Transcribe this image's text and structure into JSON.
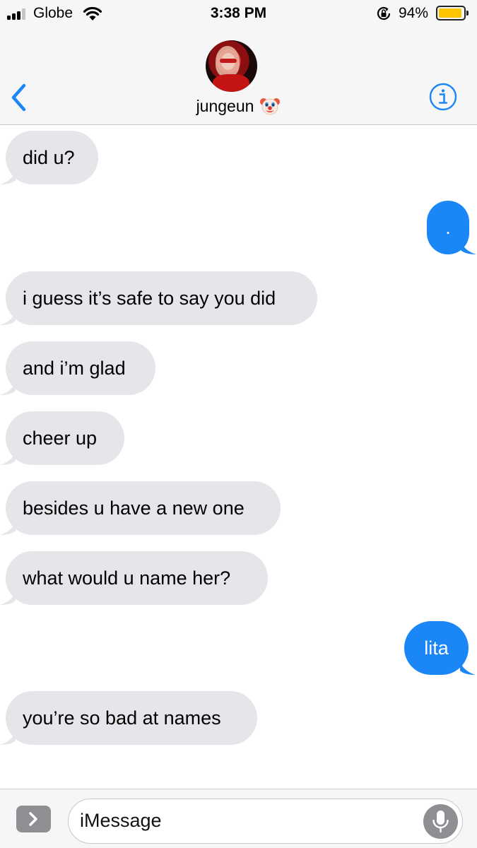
{
  "status_bar": {
    "carrier": "Globe",
    "signal_bars_filled": 3,
    "signal_bars_total": 4,
    "time": "3:38 PM",
    "battery_percent": "94%",
    "battery_level": 0.94,
    "battery_color": "#fdc500",
    "icons": [
      "signal-icon",
      "wifi-icon",
      "rotation-lock-icon",
      "battery-icon"
    ]
  },
  "header": {
    "contact_name": "jungeun",
    "contact_emoji": "clown-face-emoji",
    "back_icon": "chevron-left-icon",
    "info_icon": "info-icon",
    "accent_color": "#1b86f5"
  },
  "messages": [
    {
      "direction": "in",
      "text": "did u?"
    },
    {
      "direction": "out",
      "text": "."
    },
    {
      "direction": "in",
      "text": "i guess it’s safe to say you did"
    },
    {
      "direction": "in",
      "text": "and i’m glad"
    },
    {
      "direction": "in",
      "text": "cheer up"
    },
    {
      "direction": "in",
      "text": "besides u have a new one"
    },
    {
      "direction": "in",
      "text": "what would u name her?"
    },
    {
      "direction": "out",
      "text": "lita"
    },
    {
      "direction": "in",
      "text": "you’re so bad at names"
    }
  ],
  "input_bar": {
    "placeholder": "iMessage",
    "value": "",
    "expand_icon": "chevron-right-icon",
    "mic_icon": "microphone-icon"
  },
  "colors": {
    "incoming_bubble": "#e5e5ea",
    "outgoing_bubble": "#1b86f5",
    "bar_background": "#f6f6f6"
  }
}
